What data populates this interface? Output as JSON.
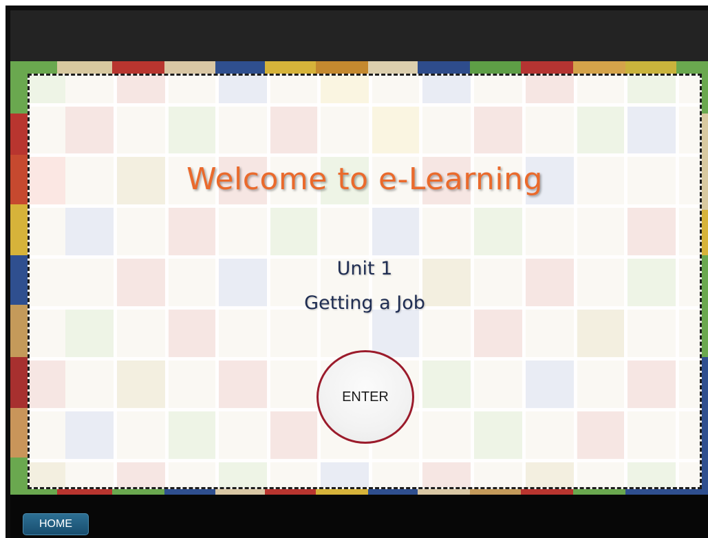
{
  "main": {
    "title": "Welcome to e-Learning",
    "unit": "Unit 1",
    "subtitle": "Getting a Job",
    "enter_label": "ENTER"
  },
  "footer": {
    "home_label": "HOME"
  },
  "colors": {
    "title": "#ea6a2c",
    "unit_text": "#1f2d52",
    "enter_border": "#9b1b2b",
    "home_button": "#1f5d82",
    "frame": "#0d0d0d",
    "topbar": "#232323"
  }
}
